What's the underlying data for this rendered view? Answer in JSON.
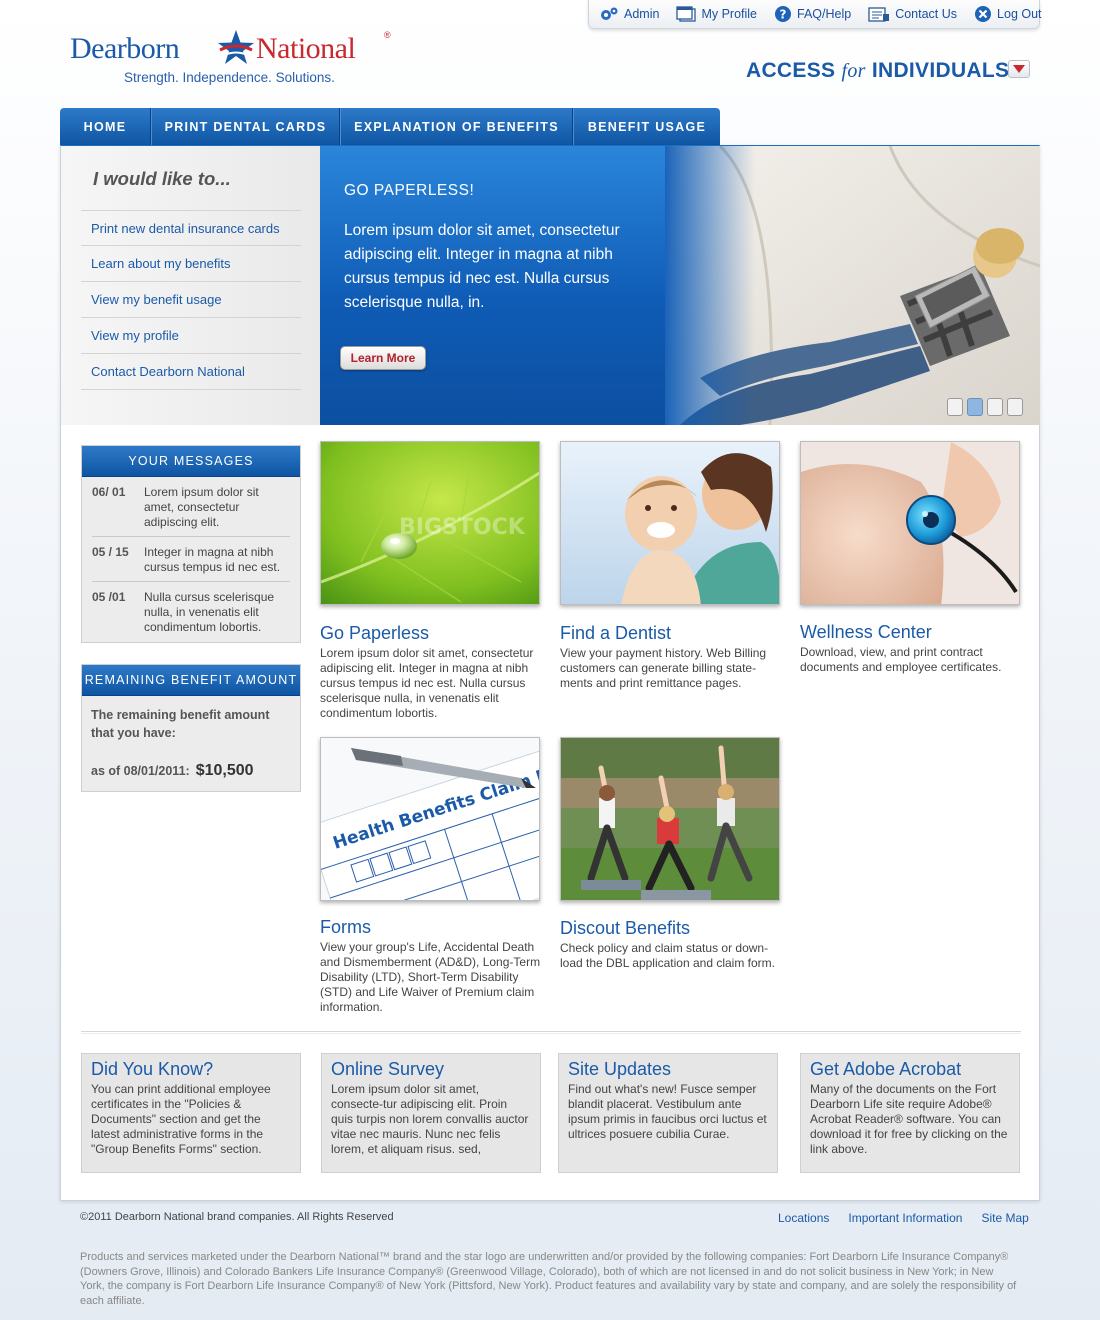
{
  "utility": {
    "admin": "Admin",
    "profile": "My Profile",
    "faq": "FAQ/Help",
    "contact": "Contact Us",
    "logout": "Log Out"
  },
  "brand": {
    "name_left": "Dearborn",
    "name_right": "National",
    "registered": "®",
    "tagline": "Strength. Independence. Solutions.",
    "primary_color": "#1b5aa8",
    "accent_color": "#c8282e"
  },
  "access": {
    "prefix": "ACCESS",
    "for": "for",
    "suffix": "INDIVIDUALS"
  },
  "nav": [
    {
      "label": "HOME"
    },
    {
      "label": "PRINT DENTAL CARDS"
    },
    {
      "label": "EXPLANATION OF BENEFITS"
    },
    {
      "label": "BENEFIT USAGE"
    }
  ],
  "like": {
    "title": "I would like to...",
    "items": [
      "Print new dental insurance cards",
      "Learn about my benefits",
      "View my benefit usage",
      "View my profile",
      "Contact Dearborn National"
    ]
  },
  "hero": {
    "title": "GO PAPERLESS!",
    "text": "Lorem ipsum dolor sit amet, consectetur adipiscing elit.  Integer in magna at nibh cursus tempus id nec est.  Nulla cursus scelerisque nulla, in.",
    "button": "Learn More",
    "slides_total": 4,
    "active_slide": 2
  },
  "messages": {
    "title": "YOUR MESSAGES",
    "items": [
      {
        "date": "06/ 01",
        "text": "Lorem ipsum dolor sit amet, consectetur adipiscing elit."
      },
      {
        "date": "05 / 15",
        "text": "Integer in magna at nibh cursus tempus id nec est."
      },
      {
        "date": "05 /01",
        "text": "Nulla cursus scelerisque nulla, in venenatis elit condimentum lobortis."
      }
    ]
  },
  "remaining": {
    "title": "REMAINING BENEFIT AMOUNT",
    "text": "The remaining benefit amount that you have:",
    "as_of": "as of 08/01/2011:",
    "amount": "$10,500"
  },
  "tiles": [
    {
      "title": "Go Paperless",
      "desc": "Lorem ipsum dolor sit amet, consectetur adipiscing elit.  Integer in magna at nibh cursus tempus id nec est.  Nulla cursus scelerisque nulla, in venenatis elit condimentum lobortis.",
      "watermark": "BIGSTOCK"
    },
    {
      "title": "Find a Dentist",
      "desc": "View your payment history. Web Billing customers can generate billing state-ments and print remittance pages."
    },
    {
      "title": "Wellness Center",
      "desc": "Download, view, and print contract documents and employee certificates."
    },
    {
      "title": "Forms",
      "desc": "View your group's Life, Accidental Death and Dismemberment (AD&D), Long-Term Disability (LTD), Short-Term Disability (STD) and Life Waiver of Premium claim information.",
      "form_heading": "Health Benefits Claim Form"
    },
    {
      "title": "Discout Benefits",
      "desc": "Check policy and claim status or down-load the DBL application and claim form."
    }
  ],
  "info_boxes": [
    {
      "title": "Did You Know?",
      "text": "You can print additional employee certificates in the \"Policies & Documents\" section and get the latest administrative forms in the \"Group Benefits Forms\" section."
    },
    {
      "title": "Online Survey",
      "text": "Lorem ipsum dolor sit amet, consecte-tur adipiscing elit. Proin quis turpis non lorem convallis auctor vitae nec mauris. Nunc nec felis lorem, et aliquam risus. sed,"
    },
    {
      "title": "Site Updates",
      "text": "Find out what's new! Fusce semper blandit placerat. Vestibulum ante ipsum primis in faucibus orci luctus et ultrices posuere cubilia Curae."
    },
    {
      "title": "Get Adobe Acrobat",
      "text": "Many of the documents on the Fort Dearborn Life site require Adobe® Acrobat Reader® software. You can download it for free by clicking on the link above."
    }
  ],
  "footer": {
    "copyright": "©2011 Dearborn National brand companies. All Rights Reserved",
    "links": [
      "Locations",
      "Important Information",
      "Site Map"
    ],
    "disclaimer": "Products and services marketed under the Dearborn National™ brand and the star logo are underwritten and/or provided by the following companies: Fort Dearborn Life Insurance Company® (Downers Grove, Illinois) and Colorado Bankers Life Insurance Company® (Greenwood Village, Colorado), both of which are not licensed in and do not solicit business in New York; in New York, the company is Fort Dearborn Life Insurance Company® of New York (Pittsford, New York). Product features and availability vary by state and company, and are solely the responsibility of each affiliate."
  },
  "icons": {
    "admin": "gears-icon",
    "profile": "profile-window-icon",
    "faq": "help-icon",
    "contact": "contact-form-icon",
    "logout": "logout-icon"
  }
}
